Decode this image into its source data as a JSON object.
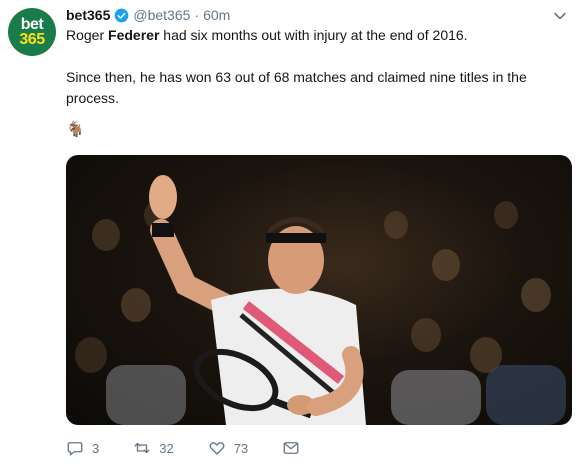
{
  "tweet": {
    "avatar": {
      "line1": "bet",
      "line2": "365"
    },
    "display_name": "bet365",
    "handle": "@bet365",
    "separator": "·",
    "time": "60m",
    "line1_prefix": "Roger ",
    "line1_bold": "Federer",
    "line1_suffix": " had six months out with injury at the end of 2016.",
    "line2": "Since then, he has won 63 out of 68 matches and claimed nine titles in the process.",
    "emoji": "🐐"
  },
  "actions": {
    "replies": "3",
    "retweets": "32",
    "likes": "73"
  },
  "colors": {
    "brand_green": "#1a7c4b",
    "brand_yellow": "#ffdf1b",
    "verified_blue": "#1da1f2",
    "muted": "#657786"
  },
  "icons": [
    "verified-badge-icon",
    "chevron-down-icon",
    "reply-icon",
    "retweet-icon",
    "like-icon",
    "message-icon"
  ]
}
